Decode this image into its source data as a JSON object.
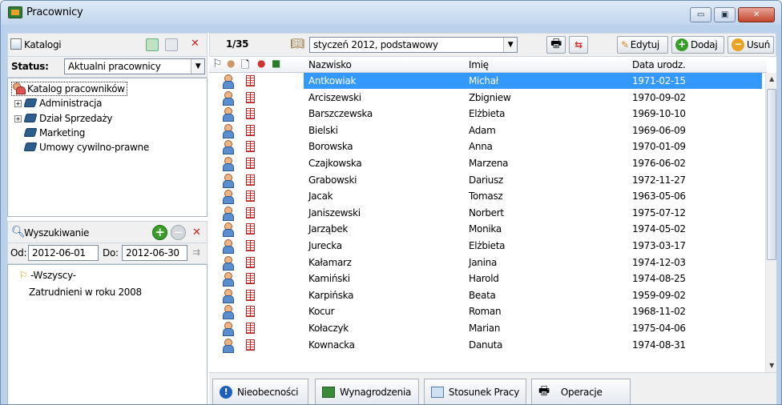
{
  "window": {
    "title": "Pracownicy",
    "min": "▭",
    "max": "▣",
    "close": "✕"
  },
  "catalogs": {
    "title": "Katalogi",
    "status_label": "Status:",
    "status_value": "Aktualni pracownicy"
  },
  "tree": {
    "root": "Katalog pracowników",
    "items": [
      {
        "label": "Administracja",
        "expandable": "+"
      },
      {
        "label": "Dział Sprzedaży",
        "expandable": "+"
      },
      {
        "label": "Marketing"
      },
      {
        "label": "Umowy cywilno-prawne"
      }
    ]
  },
  "search": {
    "title": "Wyszukiwanie",
    "from_label": "Od:",
    "from_value": "2012-06-01",
    "to_label": "Do:",
    "to_value": "2012-06-30",
    "results": [
      "-Wszyscy-",
      "Zatrudnieni w roku 2008"
    ]
  },
  "toolbar": {
    "counter": "1/35",
    "period": "styczeń 2012, podstawowy",
    "edit": "Edytuj",
    "add": "Dodaj",
    "delete": "Usuń"
  },
  "columns": {
    "lastname": "Nazwisko",
    "firstname": "Imię",
    "birthdate": "Data urodz."
  },
  "rows": [
    {
      "lastname": "Antkowiak",
      "firstname": "Michał",
      "birthdate": "1971-02-15"
    },
    {
      "lastname": "Arciszewski",
      "firstname": "Zbigniew",
      "birthdate": "1970-09-02"
    },
    {
      "lastname": "Barszczewska",
      "firstname": "Elżbieta",
      "birthdate": "1969-10-10"
    },
    {
      "lastname": "Bielski",
      "firstname": "Adam",
      "birthdate": "1969-06-09"
    },
    {
      "lastname": "Borowska",
      "firstname": "Anna",
      "birthdate": "1970-01-09"
    },
    {
      "lastname": "Czajkowska",
      "firstname": "Marzena",
      "birthdate": "1976-06-02"
    },
    {
      "lastname": "Grabowski",
      "firstname": "Dariusz",
      "birthdate": "1972-11-27"
    },
    {
      "lastname": "Jacak",
      "firstname": "Tomasz",
      "birthdate": "1963-05-06"
    },
    {
      "lastname": "Janiszewski",
      "firstname": "Norbert",
      "birthdate": "1975-07-12"
    },
    {
      "lastname": "Jarząbek",
      "firstname": "Monika",
      "birthdate": "1974-05-02"
    },
    {
      "lastname": "Jurecka",
      "firstname": "Elżbieta",
      "birthdate": "1973-03-17"
    },
    {
      "lastname": "Kałamarz",
      "firstname": "Janina",
      "birthdate": "1974-12-03"
    },
    {
      "lastname": "Kamiński",
      "firstname": "Harold",
      "birthdate": "1974-08-25"
    },
    {
      "lastname": "Karpińska",
      "firstname": "Beata",
      "birthdate": "1959-09-02"
    },
    {
      "lastname": "Kocur",
      "firstname": "Roman",
      "birthdate": "1968-11-02"
    },
    {
      "lastname": "Kołaczyk",
      "firstname": "Marian",
      "birthdate": "1975-04-06"
    },
    {
      "lastname": "Kownacka",
      "firstname": "Danuta",
      "birthdate": "1974-08-31"
    }
  ],
  "tabs": [
    "Nieobecności",
    "Wynagrodzenia",
    "Stosunek Pracy",
    "Operacje"
  ],
  "colors": {
    "selection": "#3399ff",
    "accent_green": "#3a9d2a",
    "delete_red": "#cc2222"
  }
}
